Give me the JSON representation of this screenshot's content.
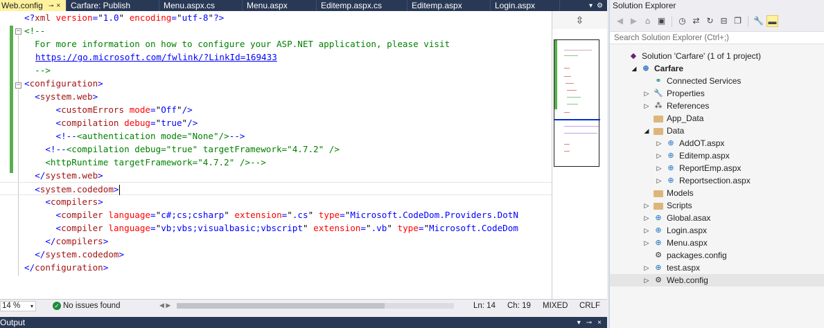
{
  "tabs": [
    {
      "label": "Web.config",
      "active": true,
      "pin": "⊸",
      "close": "×"
    },
    {
      "label": "Carfare: Publish"
    },
    {
      "label": "Menu.aspx.cs"
    },
    {
      "label": "Menu.aspx"
    },
    {
      "label": "Editemp.aspx.cs"
    },
    {
      "label": "Editemp.aspx"
    },
    {
      "label": "Login.aspx"
    }
  ],
  "tabstrip_tools": {
    "dropdown": "▾",
    "settings": "⚙"
  },
  "editor": {
    "lines": [
      "<?xml version=\"1.0\" encoding=\"utf-8\"?>",
      "<!--",
      "  For more information on how to configure your ASP.NET application, please visit",
      "  https://go.microsoft.com/fwlink/?LinkId=169433",
      "  -->",
      "<configuration>",
      "  <system.web>",
      "      <customErrors mode=\"Off\"/>",
      "      <compilation debug=\"true\"/>",
      "      <!--<authentication mode=\"None\"/>-->",
      "    <!--<compilation debug=\"true\" targetFramework=\"4.7.2\" />",
      "    <httpRuntime targetFramework=\"4.7.2\" />-->",
      "  </system.web>",
      "  <system.codedom>",
      "    <compilers>",
      "      <compiler language=\"c#;cs;csharp\" extension=\".cs\" type=\"Microsoft.CodeDom.Providers.DotN",
      "      <compiler language=\"vb;vbs;visualbasic;vbscript\" extension=\".vb\" type=\"Microsoft.CodeDom",
      "    </compilers>",
      "  </system.codedom>",
      "</configuration>"
    ]
  },
  "status": {
    "zoom": "14 %",
    "issues": "No issues found",
    "line": "Ln: 14",
    "col": "Ch: 19",
    "mode": "MIXED",
    "eol": "CRLF"
  },
  "output_panel": {
    "title": "Output"
  },
  "solution_explorer": {
    "title": "Solution Explorer",
    "search_placeholder": "Search Solution Explorer (Ctrl+;)",
    "tree": [
      {
        "label": "Solution 'Carfare' (1 of 1 project)",
        "icon": "solution-icon",
        "level": 0,
        "arrow": ""
      },
      {
        "label": "Carfare",
        "icon": "web-project-icon",
        "level": 1,
        "arrow": "◢",
        "bold": true
      },
      {
        "label": "Connected Services",
        "icon": "connected-services-icon",
        "level": 2,
        "arrow": ""
      },
      {
        "label": "Properties",
        "icon": "wrench-icon",
        "level": 2,
        "arrow": "▷"
      },
      {
        "label": "References",
        "icon": "references-icon",
        "level": 2,
        "arrow": "▷"
      },
      {
        "label": "App_Data",
        "icon": "folder-icon",
        "level": 2,
        "arrow": ""
      },
      {
        "label": "Data",
        "icon": "folder-icon",
        "level": 2,
        "arrow": "◢"
      },
      {
        "label": "AddOT.aspx",
        "icon": "aspx-file-icon",
        "level": 3,
        "arrow": "▷"
      },
      {
        "label": "Editemp.aspx",
        "icon": "aspx-file-icon",
        "level": 3,
        "arrow": "▷"
      },
      {
        "label": "ReportEmp.aspx",
        "icon": "aspx-file-icon",
        "level": 3,
        "arrow": "▷"
      },
      {
        "label": "Reportsection.aspx",
        "icon": "aspx-file-icon",
        "level": 3,
        "arrow": "▷"
      },
      {
        "label": "Models",
        "icon": "folder-icon",
        "level": 2,
        "arrow": ""
      },
      {
        "label": "Scripts",
        "icon": "folder-icon",
        "level": 2,
        "arrow": "▷"
      },
      {
        "label": "Global.asax",
        "icon": "asax-file-icon",
        "level": 2,
        "arrow": "▷"
      },
      {
        "label": "Login.aspx",
        "icon": "aspx-file-icon",
        "level": 2,
        "arrow": "▷"
      },
      {
        "label": "Menu.aspx",
        "icon": "aspx-file-icon",
        "level": 2,
        "arrow": "▷"
      },
      {
        "label": "packages.config",
        "icon": "config-file-icon",
        "level": 2,
        "arrow": ""
      },
      {
        "label": "test.aspx",
        "icon": "aspx-file-icon",
        "level": 2,
        "arrow": "▷"
      },
      {
        "label": "Web.config",
        "icon": "config-file-icon",
        "level": 2,
        "arrow": "▷",
        "selected": true
      }
    ]
  },
  "colors": {
    "tab_strip": "#293955",
    "active_tab": "#fff29d",
    "change_marker": "#57b04e",
    "xml_delimiter": "#0000ff",
    "xml_element": "#a31515",
    "xml_attribute": "#ff0000",
    "xml_comment": "#008000"
  }
}
